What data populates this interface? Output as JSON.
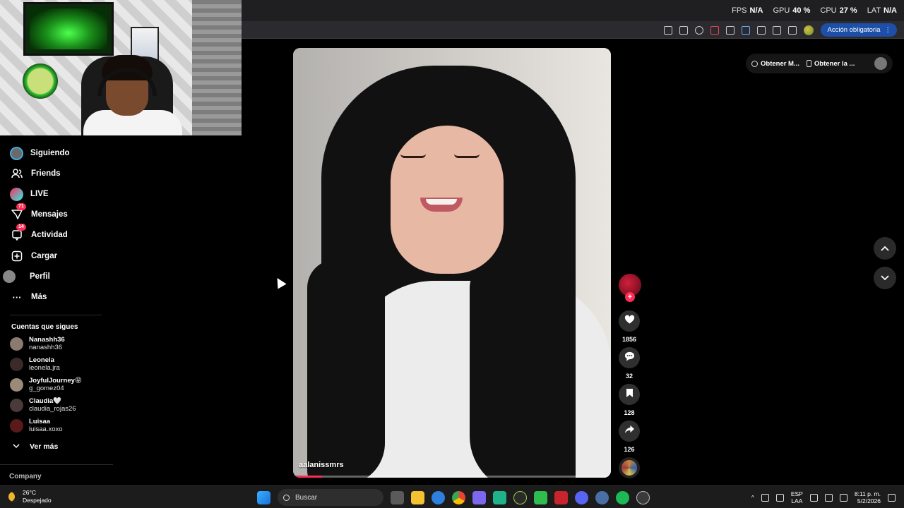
{
  "perf_overlay": {
    "items": [
      {
        "label": "FPS",
        "value": "N/A"
      },
      {
        "label": "GPU",
        "value": "40 %"
      },
      {
        "label": "CPU",
        "value": "27 %"
      },
      {
        "label": "LAT",
        "value": "N/A"
      }
    ]
  },
  "browser": {
    "action_button_label": "Acción obligatoria"
  },
  "sidebar": {
    "items": [
      {
        "label": "Siguiendo",
        "icon": "following-avatar-icon"
      },
      {
        "label": "Friends",
        "icon": "friends-icon"
      },
      {
        "label": "LIVE",
        "icon": "live-icon"
      },
      {
        "label": "Mensajes",
        "icon": "messages-icon",
        "badge": "71"
      },
      {
        "label": "Actividad",
        "icon": "activity-icon",
        "badge": "14"
      },
      {
        "label": "Cargar",
        "icon": "upload-icon"
      },
      {
        "label": "Perfil",
        "icon": "profile-icon"
      },
      {
        "label": "Más",
        "icon": "more-icon"
      }
    ],
    "following_title": "Cuentas que sigues",
    "following": [
      {
        "name": "Nanashh36",
        "handle": "nanashh36"
      },
      {
        "name": "Leonela",
        "handle": "leonela.jra"
      },
      {
        "name": "JoyfulJourney😝",
        "handle": "g_gomez04"
      },
      {
        "name": "Claudia🤍",
        "handle": "claudia_rojas26"
      },
      {
        "name": "Luisaa",
        "handle": "luisaa.xoxo"
      }
    ],
    "see_more_label": "Ver más",
    "company_label": "Company"
  },
  "header_right": {
    "get_app_label": "Obtener M...",
    "get_device_label": "Obtener la ..."
  },
  "video": {
    "username": "aalanissmrs",
    "progress": 0.09
  },
  "actions": {
    "likes": "1856",
    "comments": "32",
    "saves": "128",
    "shares": "126"
  },
  "taskbar": {
    "temperature": "26°C",
    "weather_text": "Despejado",
    "search_placeholder": "Buscar",
    "lang_top": "ESP",
    "lang_bottom": "LAA",
    "time": "8:11 p. m.",
    "date": "5/2/2026"
  },
  "colors": {
    "accent": "#fe2c55",
    "background": "#000000",
    "action_button": "#1d4fa8"
  }
}
